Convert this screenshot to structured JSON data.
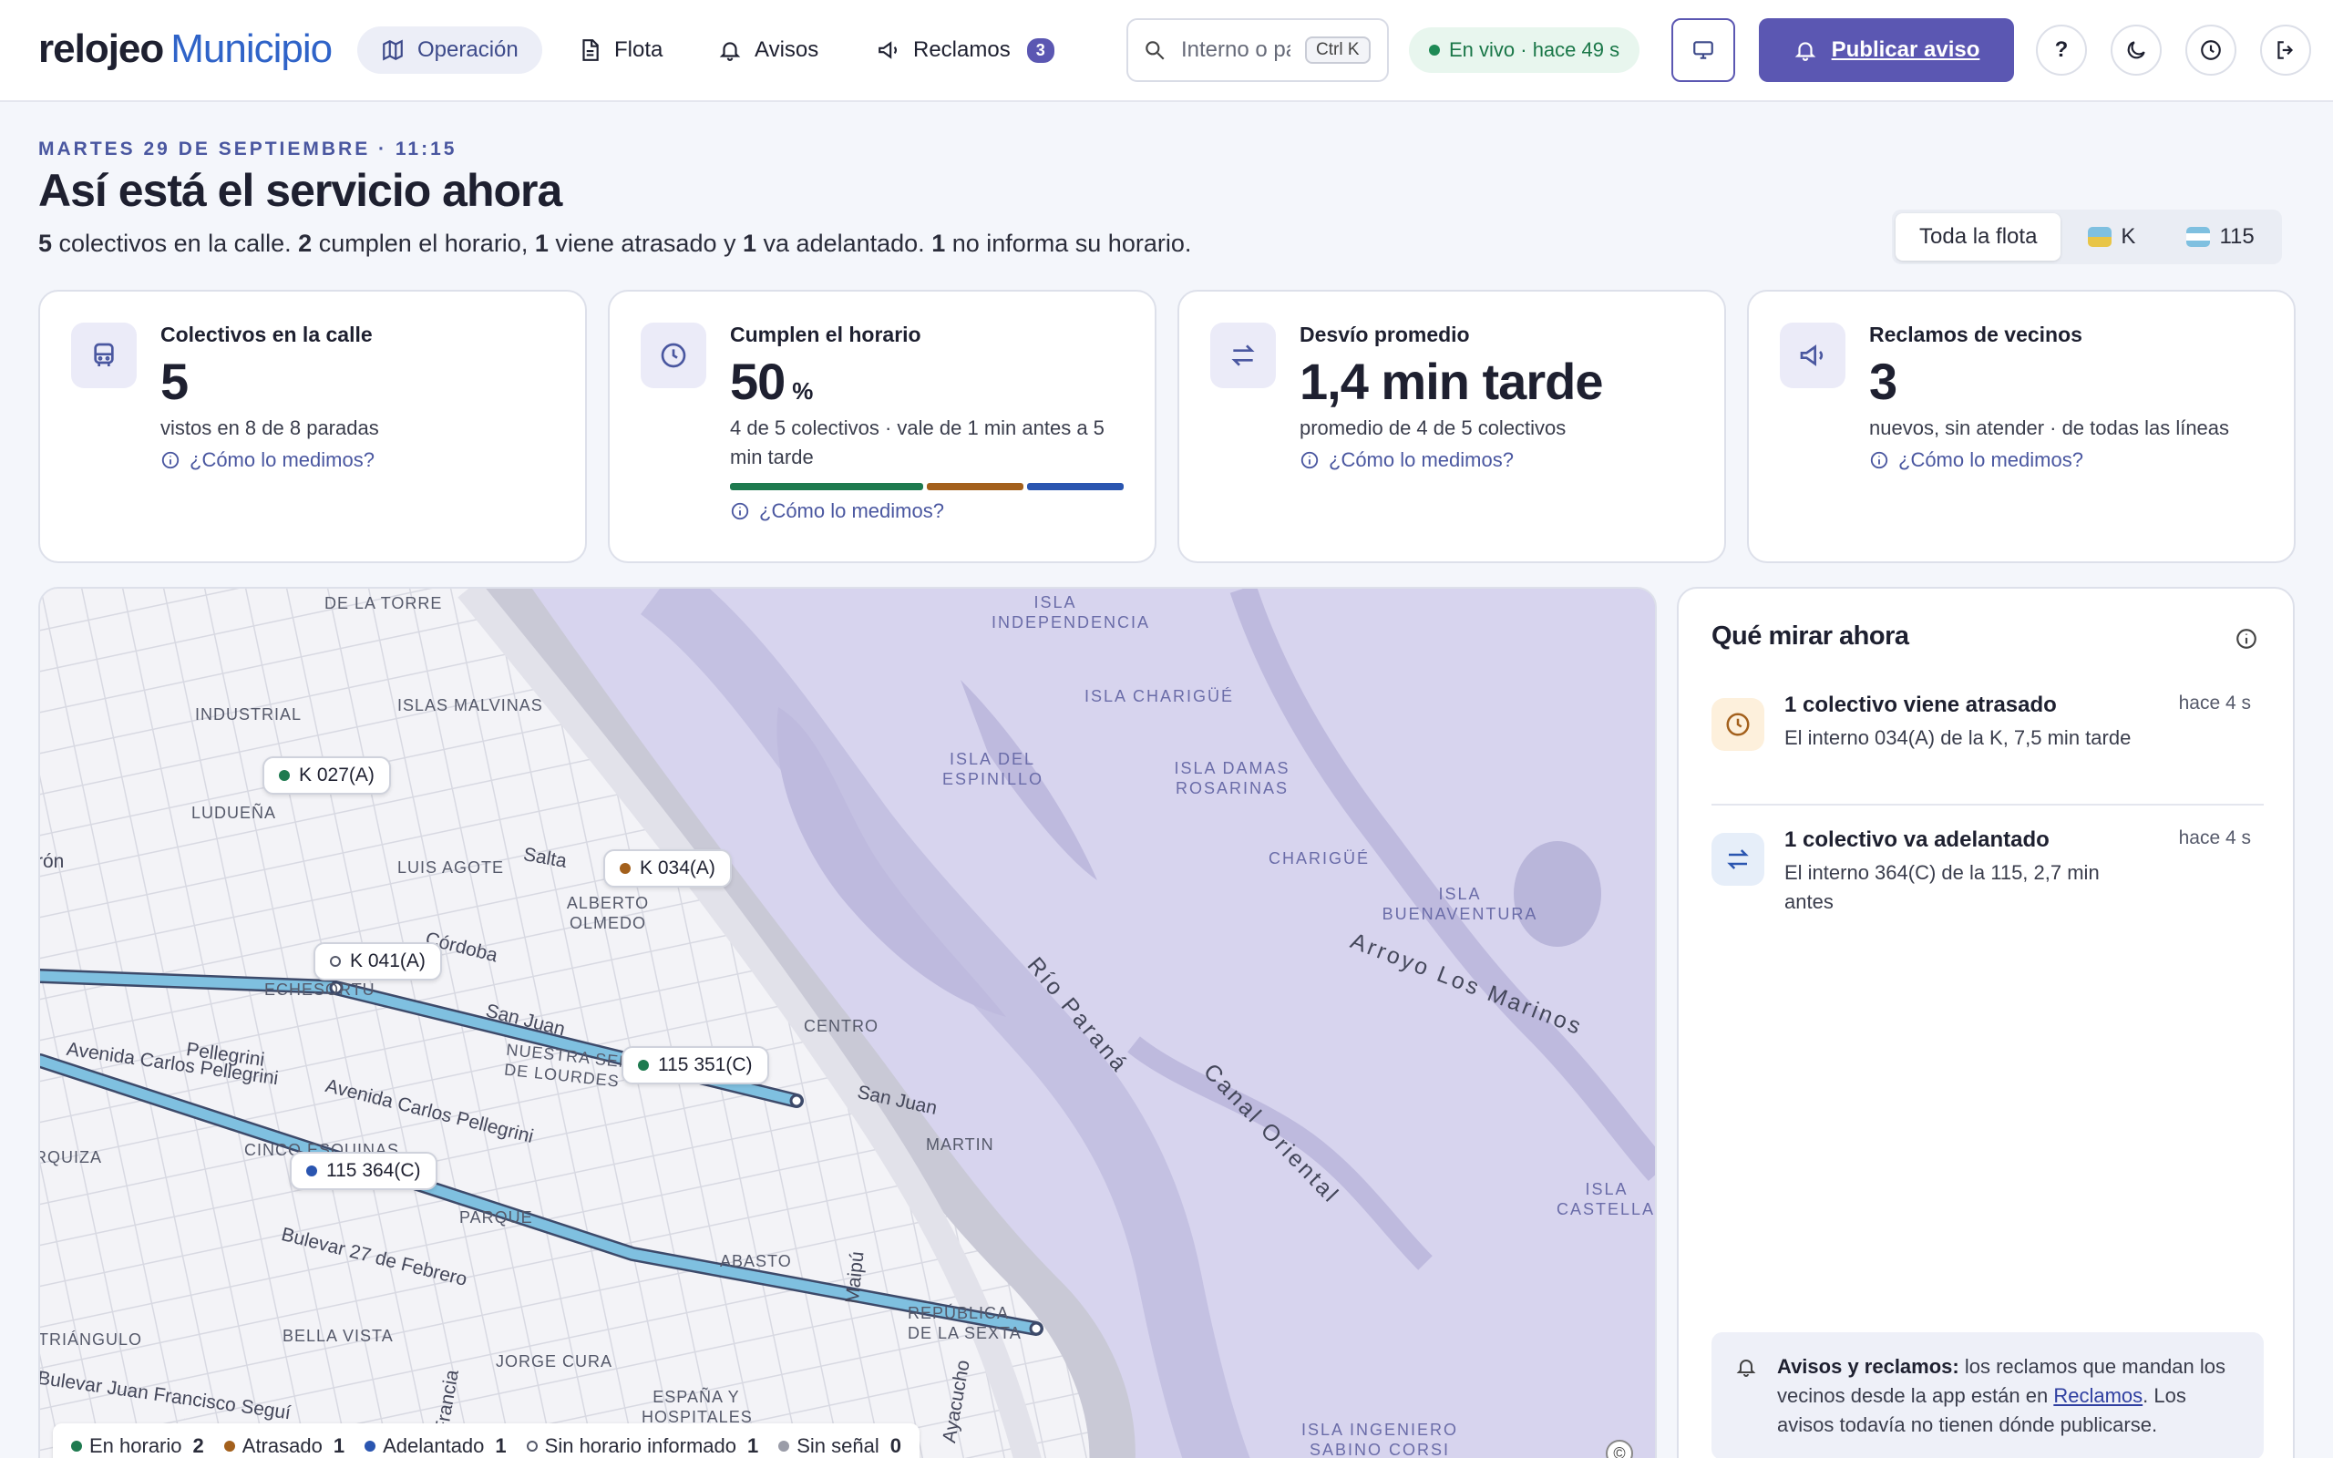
{
  "app": {
    "brand": "relojeo",
    "brand_suffix": "Municipio"
  },
  "nav": [
    {
      "label": "Operación",
      "icon": "map-icon",
      "active": true
    },
    {
      "label": "Flota",
      "icon": "document-icon"
    },
    {
      "label": "Avisos",
      "icon": "bell-icon"
    },
    {
      "label": "Reclamos",
      "icon": "megaphone-icon",
      "badge": "3"
    }
  ],
  "search": {
    "placeholder": "Interno o patente",
    "shortcut": "Ctrl K"
  },
  "live": {
    "label": "En vivo · hace 49 s"
  },
  "toolbar": {
    "publish_label": "Publicar aviso",
    "help_label": "?"
  },
  "header": {
    "date": "MARTES 29 DE SEPTIEMBRE · 11:15",
    "title": "Así está el servicio ahora",
    "summary": {
      "n_total": "5",
      "t1": " colectivos en la calle. ",
      "n_ok": "2",
      "t2": " cumplen el horario, ",
      "n_late": "1",
      "t3": " viene atrasado y ",
      "n_early": "1",
      "t4": " va adelantado. ",
      "n_none": "1",
      "t5": " no informa su horario."
    }
  },
  "filter": {
    "options": [
      "Toda la flota",
      "K",
      "115"
    ],
    "selected": "Toda la flota"
  },
  "cards": [
    {
      "title": "Colectivos en la calle",
      "value": "5",
      "sub": "vistos en 8 de 8 paradas",
      "link": "¿Cómo lo medimos?",
      "icon": "bus-icon"
    },
    {
      "title": "Cumplen el horario",
      "value": "50",
      "unit": "%",
      "sub": "4 de 5 colectivos · vale de 1 min antes a 5 min tarde",
      "link": "¿Cómo lo medimos?",
      "icon": "clock-icon",
      "breakdown": [
        0.5,
        0.25,
        0.25
      ]
    },
    {
      "title": "Desvío promedio",
      "value": "1,4 min tarde",
      "sub": "promedio de 4 de 5 colectivos",
      "link": "¿Cómo lo medimos?",
      "icon": "arrows-icon"
    },
    {
      "title": "Reclamos de vecinos",
      "value": "3",
      "sub": "nuevos, sin atender · de todas las líneas",
      "link": "¿Cómo lo medimos?",
      "icon": "megaphone-icon"
    }
  ],
  "map": {
    "labels": [
      "DE LA TORRE",
      "INDUSTRIAL",
      "ISLAS MALVINAS",
      "LUDUEÑA",
      "LUIS AGOTE",
      "Salta",
      "ALBERTO OLMEDO",
      "Córdoba",
      "ECHESORTU",
      "San Juan",
      "NUESTRA SEÑORA DE LOURDES",
      "CENTRO",
      "San Juan",
      "Avenida Carlos Pellegrini",
      "Avenida Carlos Pellegrini",
      "MARTIN",
      "CINCO ESQUINAS",
      "PARQUE",
      "Bulevar 27 de Febrero",
      "ABASTO",
      "REPÚBLICA DE LA SEXTA",
      "BELLA VISTA",
      "JORGE CURA",
      "ESPAÑA Y HOSPITALES",
      "TRIÁNGULO",
      "Bulevar Juan Francisco Seguí",
      "Francia",
      "Maipú",
      "Ayacucho",
      "RQUIZA",
      "ISLA INDEPENDENCIA",
      "ISLA CHARIGÜÉ",
      "ISLA DEL ESPINILLO",
      "ISLA DAMAS ROSARINAS",
      "CHARIGÜÉ",
      "ISLA BUENAVENTURA",
      "Arroyo Los Marinos",
      "Río Paraná",
      "Canal Oriental",
      "ISLA CASTELLANO",
      "ISLA INGENIERO SABINO CORSI",
      "rón",
      "Pellegrini"
    ],
    "buses": [
      {
        "label": "K 027(A)",
        "status": "on-time"
      },
      {
        "label": "K 034(A)",
        "status": "late"
      },
      {
        "label": "K 041(A)",
        "status": "no-schedule"
      },
      {
        "label": "115 351(C)",
        "status": "on-time"
      },
      {
        "label": "115 364(C)",
        "status": "early"
      }
    ],
    "legend": [
      {
        "label": "En horario",
        "count": "2",
        "color": "#1e7a4f"
      },
      {
        "label": "Atrasado",
        "count": "1",
        "color": "#a3601c"
      },
      {
        "label": "Adelantado",
        "count": "1",
        "color": "#2a55b0"
      },
      {
        "label": "Sin horario informado",
        "count": "1",
        "color": "#ffffff"
      },
      {
        "label": "Sin señal",
        "count": "0",
        "color": "#9a9ca8"
      }
    ],
    "attribution": "©"
  },
  "panel": {
    "title": "Qué mirar ahora",
    "alerts": [
      {
        "title": "1 colectivo viene atrasado",
        "desc": "El interno 034(A) de la K, 7,5 min tarde",
        "time": "hace 4 s",
        "icon": "clock-icon"
      },
      {
        "title": "1 colectivo va adelantado",
        "desc": "El interno 364(C) de la 115, 2,7 min antes",
        "time": "hace 4 s",
        "icon": "arrows-icon"
      }
    ],
    "note": {
      "bold": "Avisos y reclamos:",
      "t1": " los reclamos que mandan los vecinos desde la app están en ",
      "link": "Reclamos",
      "t2": ". Los avisos todavía no tienen dónde publicarse."
    }
  },
  "colors": {
    "accent": "#5b57b2",
    "brand_blue": "#2f63c8",
    "on_time": "#1e7a4f",
    "late": "#a3601c",
    "early": "#2a55b0",
    "route": "#7fc0e0",
    "water": "#d7d4ee"
  }
}
